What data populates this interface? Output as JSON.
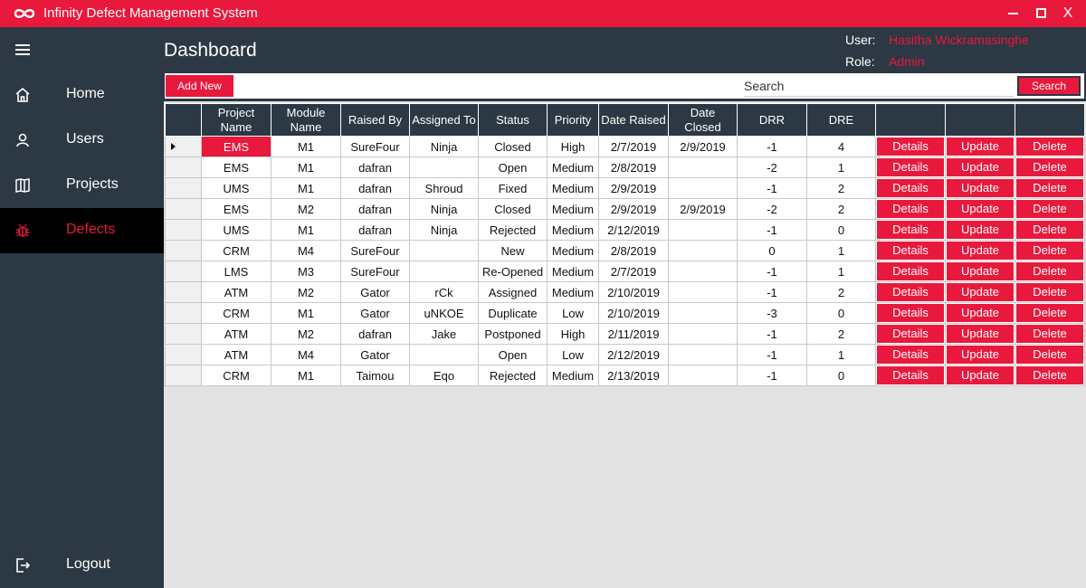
{
  "app": {
    "title": "Infinity Defect Management System",
    "close_label": "X",
    "accent": "#e8193c",
    "dark": "#2c3844"
  },
  "sidebar": {
    "items": [
      {
        "label": "Home",
        "icon": "home-icon"
      },
      {
        "label": "Users",
        "icon": "user-icon"
      },
      {
        "label": "Projects",
        "icon": "projects-icon"
      },
      {
        "label": "Defects",
        "icon": "bug-icon",
        "active": true
      }
    ],
    "logout_label": "Logout"
  },
  "header": {
    "title": "Dashboard",
    "user_label": "User:",
    "user_value": "Hasitha Wickramasinghe",
    "role_label": "Role:",
    "role_value": "Admin"
  },
  "toolbar": {
    "add_label": "Add New",
    "search_placeholder": "Search",
    "search_label": "Search"
  },
  "table": {
    "headers": [
      "Project Name",
      "Module Name",
      "Raised By",
      "Assigned To",
      "Status",
      "Priority",
      "Date Raised",
      "Date Closed",
      "DRR",
      "DRE",
      "",
      "",
      ""
    ],
    "action_labels": {
      "details": "Details",
      "update": "Update",
      "delete": "Delete"
    },
    "rows": [
      [
        "EMS",
        "M1",
        "SureFour",
        "Ninja",
        "Closed",
        "High",
        "2/7/2019",
        "2/9/2019",
        "-1",
        "4"
      ],
      [
        "EMS",
        "M1",
        "dafran",
        "",
        "Open",
        "Medium",
        "2/8/2019",
        "",
        "-2",
        "1"
      ],
      [
        "UMS",
        "M1",
        "dafran",
        "Shroud",
        "Fixed",
        "Medium",
        "2/9/2019",
        "",
        "-1",
        "2"
      ],
      [
        "EMS",
        "M2",
        "dafran",
        "Ninja",
        "Closed",
        "Medium",
        "2/9/2019",
        "2/9/2019",
        "-2",
        "2"
      ],
      [
        "UMS",
        "M1",
        "dafran",
        "Ninja",
        "Rejected",
        "Medium",
        "2/12/2019",
        "",
        "-1",
        "0"
      ],
      [
        "CRM",
        "M4",
        "SureFour",
        "",
        "New",
        "Medium",
        "2/8/2019",
        "",
        "0",
        "1"
      ],
      [
        "LMS",
        "M3",
        "SureFour",
        "",
        "Re-Opened",
        "Medium",
        "2/7/2019",
        "",
        "-1",
        "1"
      ],
      [
        "ATM",
        "M2",
        "Gator",
        "rCk",
        "Assigned",
        "Medium",
        "2/10/2019",
        "",
        "-1",
        "2"
      ],
      [
        "CRM",
        "M1",
        "Gator",
        "uNKOE",
        "Duplicate",
        "Low",
        "2/10/2019",
        "",
        "-3",
        "0"
      ],
      [
        "ATM",
        "M2",
        "dafran",
        "Jake",
        "Postponed",
        "High",
        "2/11/2019",
        "",
        "-1",
        "2"
      ],
      [
        "ATM",
        "M4",
        "Gator",
        "",
        "Open",
        "Low",
        "2/12/2019",
        "",
        "-1",
        "1"
      ],
      [
        "CRM",
        "M1",
        "Taimou",
        "Eqo",
        "Rejected",
        "Medium",
        "2/13/2019",
        "",
        "-1",
        "0"
      ]
    ]
  }
}
